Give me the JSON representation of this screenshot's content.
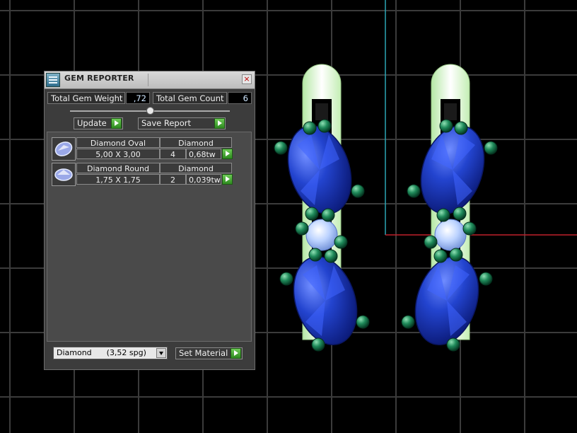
{
  "panel": {
    "title": "GEM REPORTER",
    "close_icon": "×",
    "total_weight_label": "Total Gem Weight",
    "total_weight_value": ",72",
    "total_count_label": "Total Gem Count",
    "total_count_value": "6",
    "update_label": "Update",
    "save_report_label": "Save Report",
    "set_material_label": "Set Material"
  },
  "gems": [
    {
      "icon": "oval-gem-icon",
      "name": "Diamond Oval",
      "material": "Diamond",
      "size": "5,00 X 3,00",
      "count": "4",
      "weight": "0,68tw"
    },
    {
      "icon": "round-gem-icon",
      "name": "Diamond Round",
      "material": "Diamond",
      "size": "1,75 X 1,75",
      "count": "2",
      "weight": "0,039tw"
    }
  ],
  "material_select": {
    "selected": "Diamond      (3,52 spg)"
  },
  "colors": {
    "background": "#000000",
    "grid": "#3a3a3a",
    "gem_blue": "#1f3fbf",
    "prong_green": "#1f8a5a",
    "axis_cyan": "#2aa6b6",
    "axis_red": "#c0202a"
  }
}
